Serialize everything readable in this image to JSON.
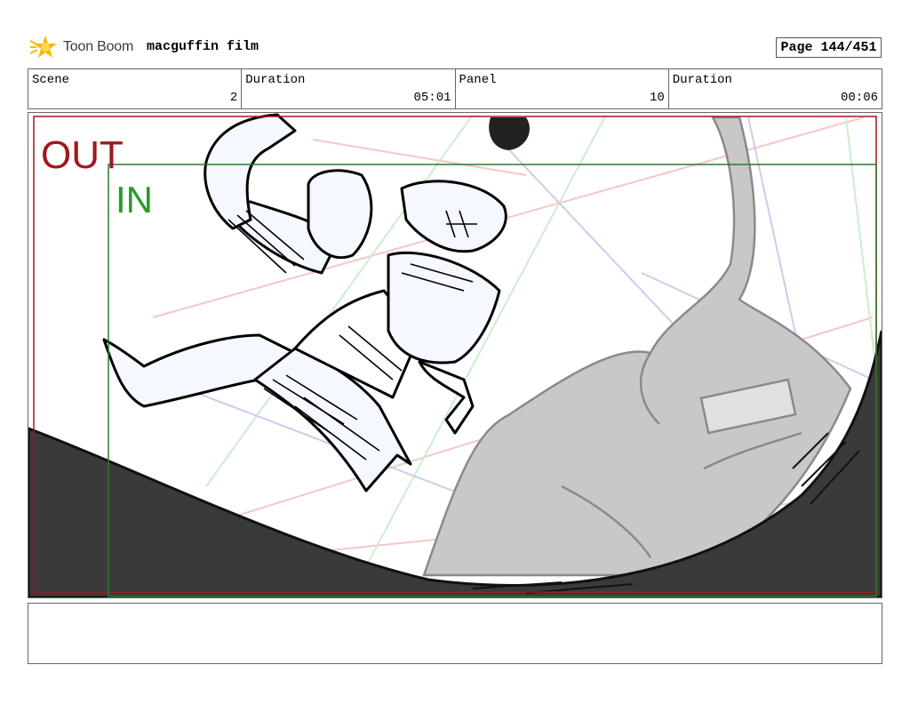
{
  "header": {
    "logo_text": "Toon Boom",
    "project_title": "macguffin film",
    "page": "Page 144/451"
  },
  "info": {
    "scene_label": "Scene",
    "scene_value": "2",
    "scene_duration_label": "Duration",
    "scene_duration_value": "05:01",
    "panel_label": "Panel",
    "panel_value": "10",
    "panel_duration_label": "Duration",
    "panel_duration_value": "00:06"
  },
  "frame": {
    "out_label": "OUT",
    "in_label": "IN",
    "out_color": "#a0181c",
    "in_color": "#2a9a2a"
  },
  "notes": {
    "text": ""
  }
}
